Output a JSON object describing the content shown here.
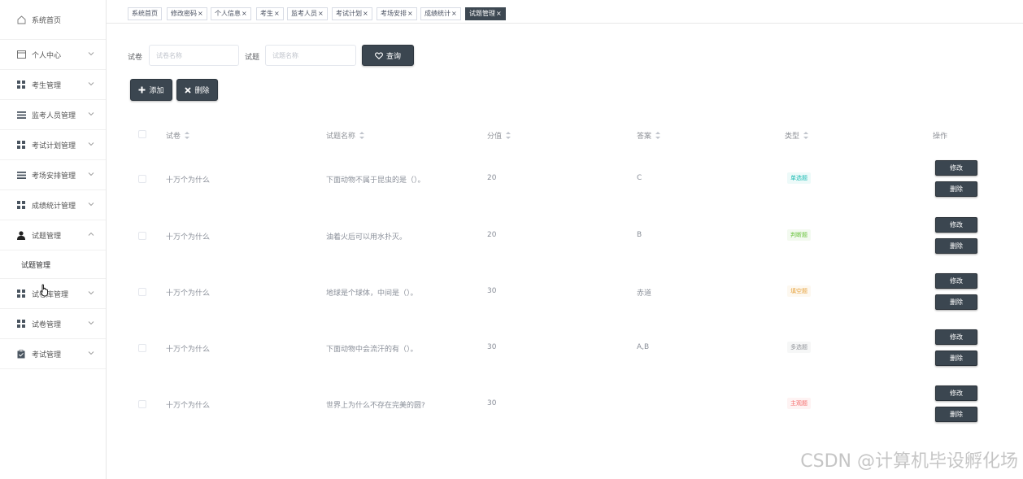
{
  "sidebar": {
    "items": [
      {
        "label": "系统首页",
        "icon": "home-icon",
        "expandable": false
      },
      {
        "label": "个人中心",
        "icon": "profile-icon",
        "expandable": true
      },
      {
        "label": "考生管理",
        "icon": "grid-icon",
        "expandable": true
      },
      {
        "label": "监考人员管理",
        "icon": "list-icon",
        "expandable": true
      },
      {
        "label": "考试计划管理",
        "icon": "grid-icon",
        "expandable": true
      },
      {
        "label": "考场安排管理",
        "icon": "list-icon",
        "expandable": true
      },
      {
        "label": "成绩统计管理",
        "icon": "grid-icon",
        "expandable": true
      },
      {
        "label": "试题管理",
        "icon": "user-icon",
        "expandable": true,
        "expanded": true
      },
      {
        "label": "试卷库管理",
        "icon": "grid-icon",
        "expandable": true
      },
      {
        "label": "试卷管理",
        "icon": "grid-icon",
        "expandable": true
      },
      {
        "label": "考试管理",
        "icon": "clipboard-icon",
        "expandable": true
      }
    ],
    "submenu": {
      "label": "试题管理"
    }
  },
  "tabs": [
    {
      "label": "系统首页",
      "closable": false
    },
    {
      "label": "修改密码",
      "closable": true
    },
    {
      "label": "个人信息",
      "closable": true
    },
    {
      "label": "考生",
      "closable": true
    },
    {
      "label": "监考人员",
      "closable": true
    },
    {
      "label": "考试计划",
      "closable": true
    },
    {
      "label": "考场安排",
      "closable": true
    },
    {
      "label": "成绩统计",
      "closable": true
    },
    {
      "label": "试题管理",
      "closable": true,
      "active": true
    }
  ],
  "search": {
    "paper_label": "试卷",
    "paper_placeholder": "试卷名称",
    "question_label": "试题",
    "question_placeholder": "试题名称",
    "query_button": "查询"
  },
  "toolbar": {
    "add_button": "添加",
    "delete_button": "删除"
  },
  "table": {
    "columns": [
      "试卷",
      "试题名称",
      "分值",
      "答案",
      "类型",
      "操作"
    ],
    "rows": [
      {
        "paper": "十万个为什么",
        "question": "下面动物不属于昆虫的是（）。",
        "score": "20",
        "answer": "C",
        "type": "单选题",
        "type_color": "#1cbbb4"
      },
      {
        "paper": "十万个为什么",
        "question": "油着火后可以用水扑灭。",
        "score": "20",
        "answer": "B",
        "type": "判断题",
        "type_color": "#67c23a"
      },
      {
        "paper": "十万个为什么",
        "question": "地球是个球体，中间是（）。",
        "score": "30",
        "answer": "赤道",
        "type": "填空题",
        "type_color": "#e6a23c"
      },
      {
        "paper": "十万个为什么",
        "question": "下面动物中会流汗的有（）。",
        "score": "30",
        "answer": "A,B",
        "type": "多选题",
        "type_color": "#909399"
      },
      {
        "paper": "十万个为什么",
        "question": "世界上为什么不存在完美的圆?",
        "score": "30",
        "answer": "",
        "type": "主观题",
        "type_color": "#f56c6c"
      }
    ],
    "edit_button": "修改",
    "delete_button": "删除"
  },
  "watermark": "CSDN @计算机毕设孵化场"
}
